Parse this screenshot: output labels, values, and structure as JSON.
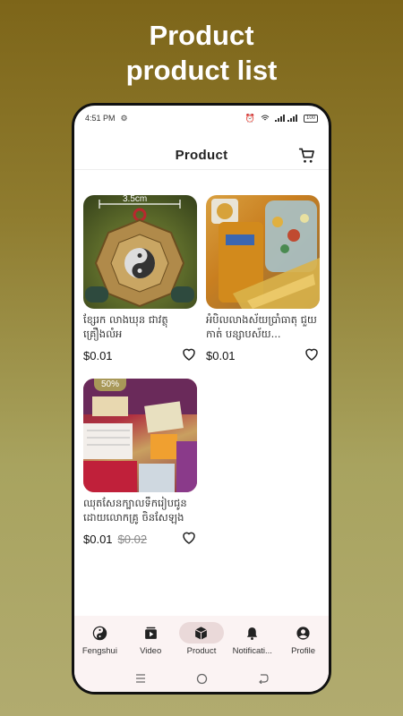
{
  "headline": {
    "line1": "Product",
    "line2": "product list"
  },
  "status_bar": {
    "time": "4:51 PM",
    "battery": "100"
  },
  "app_bar": {
    "title": "Product"
  },
  "products": [
    {
      "name": "ខ្សែរក លាងឃុន ជាវត្ថុគ្រឿងលំអ",
      "price": "$0.01",
      "old_price": "",
      "discount": "",
      "image_label": "3.5cm"
    },
    {
      "name": "អំបិលលាងស័យប្រាំធាតុ ជួយកាត់ បន្សាបស័យ...",
      "price": "$0.01",
      "old_price": "",
      "discount": ""
    },
    {
      "name": "ឈុតសែនក្បាលទឹករៀបជូន ដោយលោកគ្រូ ចិនសែឡុង",
      "price": "$0.01",
      "old_price": "$0.02",
      "discount": "50%"
    }
  ],
  "bottom_nav": [
    {
      "label": "Fengshui",
      "icon": "yin-yang-icon",
      "active": false
    },
    {
      "label": "Video",
      "icon": "video-icon",
      "active": false
    },
    {
      "label": "Product",
      "icon": "box-icon",
      "active": true
    },
    {
      "label": "Notificati...",
      "icon": "bell-icon",
      "active": false
    },
    {
      "label": "Profile",
      "icon": "profile-icon",
      "active": false
    }
  ]
}
